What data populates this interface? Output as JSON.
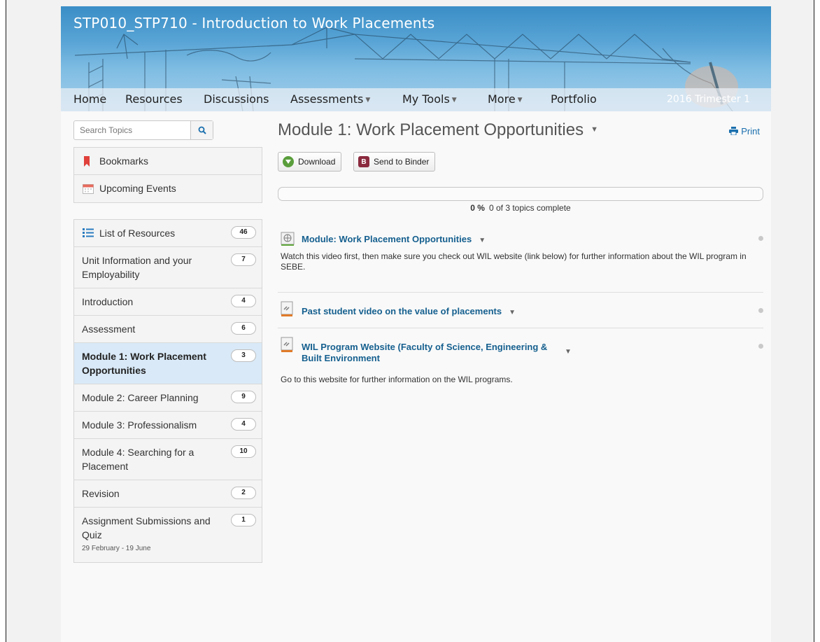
{
  "course": {
    "title": "STP010_STP710 - Introduction to Work Placements",
    "term": "2016 Trimester 1"
  },
  "nav": {
    "items": [
      {
        "label": "Home",
        "dropdown": false
      },
      {
        "label": "Resources",
        "dropdown": false
      },
      {
        "label": "Discussions",
        "dropdown": false
      },
      {
        "label": "Assessments",
        "dropdown": true
      },
      {
        "label": "My Tools",
        "dropdown": true
      },
      {
        "label": "More",
        "dropdown": true
      },
      {
        "label": "Portfolio",
        "dropdown": false
      }
    ]
  },
  "sidebar": {
    "search_placeholder": "Search Topics",
    "quick_links": [
      {
        "label": "Bookmarks",
        "icon": "bookmark-icon"
      },
      {
        "label": "Upcoming Events",
        "icon": "calendar-icon"
      }
    ],
    "list_header": {
      "label": "List of Resources",
      "count": "46",
      "icon": "list-icon"
    },
    "modules": [
      {
        "label": "Unit Information and your Employability",
        "count": "7",
        "selected": false,
        "sub": ""
      },
      {
        "label": "Introduction",
        "count": "4",
        "selected": false,
        "sub": ""
      },
      {
        "label": "Assessment",
        "count": "6",
        "selected": false,
        "sub": ""
      },
      {
        "label": "Module 1: Work Placement Opportunities",
        "count": "3",
        "selected": true,
        "sub": ""
      },
      {
        "label": "Module 2: Career Planning",
        "count": "9",
        "selected": false,
        "sub": ""
      },
      {
        "label": "Module 3: Professionalism",
        "count": "4",
        "selected": false,
        "sub": ""
      },
      {
        "label": "Module 4: Searching for a Placement",
        "count": "10",
        "selected": false,
        "sub": ""
      },
      {
        "label": "Revision",
        "count": "2",
        "selected": false,
        "sub": ""
      },
      {
        "label": "Assignment Submissions and Quiz",
        "count": "1",
        "selected": false,
        "sub": "29 February - 19 June"
      }
    ]
  },
  "main": {
    "title": "Module 1: Work Placement Opportunities",
    "print_label": "Print",
    "download_label": "Download",
    "binder_label": "Send to Binder",
    "progress": {
      "percent": 0,
      "percent_label": "0 %",
      "text": "0 of 3 topics complete"
    },
    "topics": [
      {
        "title": "Module: Work Placement Opportunities",
        "icon": "web-page-icon",
        "description": "Watch this video first, then make sure you check out WIL website (link below) for further information about the WIL program in SEBE."
      },
      {
        "title": "Past student video on the value of placements",
        "icon": "link-icon",
        "description": ""
      },
      {
        "title": "WIL Program Website (Faculty of Science, Engineering & Built Environment",
        "icon": "link-icon",
        "description": "Go to this website for further information on the WIL programs."
      }
    ]
  },
  "colors": {
    "banner": "#3a8ec6",
    "link": "#16608f",
    "selected_row": "#d9e9f7",
    "bookmark": "#e0413b"
  }
}
